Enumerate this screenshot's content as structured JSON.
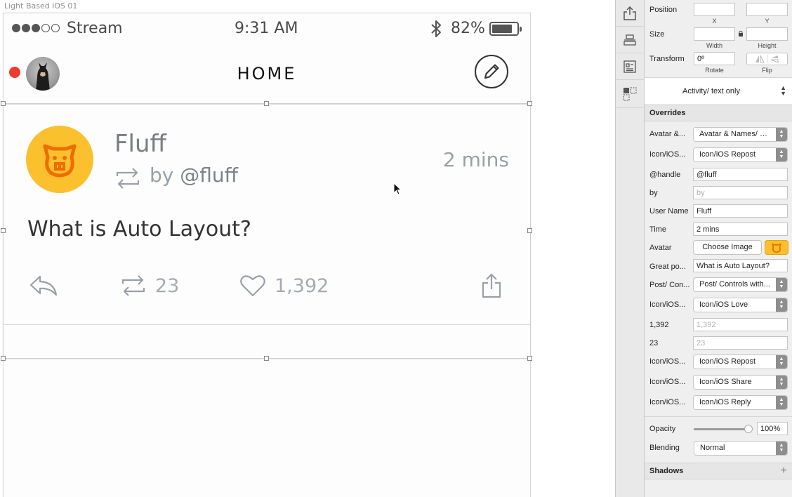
{
  "canvas": {
    "artboard_label": "Light Based iOS 01",
    "status_bar": {
      "carrier": "Stream",
      "time": "9:31 AM",
      "battery": "82%",
      "battery_level": 0.82
    },
    "nav": {
      "title": "HOME"
    },
    "post": {
      "user_name": "Fluff",
      "by": "by",
      "handle": "@fluff",
      "time": "2 mins",
      "text": "What is Auto Layout?",
      "repost_count": "23",
      "love_count": "1,392"
    }
  },
  "inspector": {
    "position": {
      "label": "Position",
      "x_label": "X",
      "y_label": "Y",
      "x": "",
      "y": ""
    },
    "size": {
      "label": "Size",
      "width_label": "Width",
      "height_label": "Height",
      "width": "",
      "height": ""
    },
    "transform": {
      "label": "Transform",
      "rotate_value": "0º",
      "rotate_label": "Rotate",
      "flip_label": "Flip"
    },
    "symbol": "Activity/ text only",
    "overrides_title": "Overrides",
    "overrides": [
      {
        "label": "Avatar &...",
        "value": "Avatar & Names/ R..."
      },
      {
        "label": "Icon/iOS...",
        "value": "Icon/iOS Repost"
      },
      {
        "label": "@handle",
        "value": "@fluff"
      },
      {
        "label": "by",
        "value": "by"
      },
      {
        "label": "User Name",
        "value": "Fluff"
      },
      {
        "label": "Time",
        "value": "2 mins"
      },
      {
        "label": "Avatar",
        "value": "Choose Image"
      },
      {
        "label": "Great po...",
        "value": "What is Auto Layout?"
      },
      {
        "label": "Post/ Con...",
        "value": "Post/ Controls with..."
      },
      {
        "label": "Icon/iOS...",
        "value": "Icon/iOS Love"
      },
      {
        "label": "1,392",
        "value": "1,392"
      },
      {
        "label": "23",
        "value": "23"
      },
      {
        "label": "Icon/iOS...",
        "value": "Icon/iOS Repost"
      },
      {
        "label": "Icon/iOS...",
        "value": "Icon/iOS Share"
      },
      {
        "label": "Icon/iOS...",
        "value": "Icon/iOS Reply"
      }
    ],
    "opacity": {
      "label": "Opacity",
      "value": "100%",
      "level": 1.0
    },
    "blending": {
      "label": "Blending",
      "value": "Normal"
    },
    "shadows": {
      "label": "Shadows",
      "add": "+"
    }
  },
  "colors": {
    "accent_avatar": "#fbc02d",
    "record_dot": "#ee3b2f",
    "bulldog_orange": "#ef6c00"
  },
  "icons": [
    "share-export-icon",
    "align-icon",
    "layout-icon",
    "grid-icon",
    "compose-pencil-icon",
    "reply-icon",
    "repost-icon",
    "heart-icon",
    "share-icon",
    "bluetooth-icon"
  ]
}
